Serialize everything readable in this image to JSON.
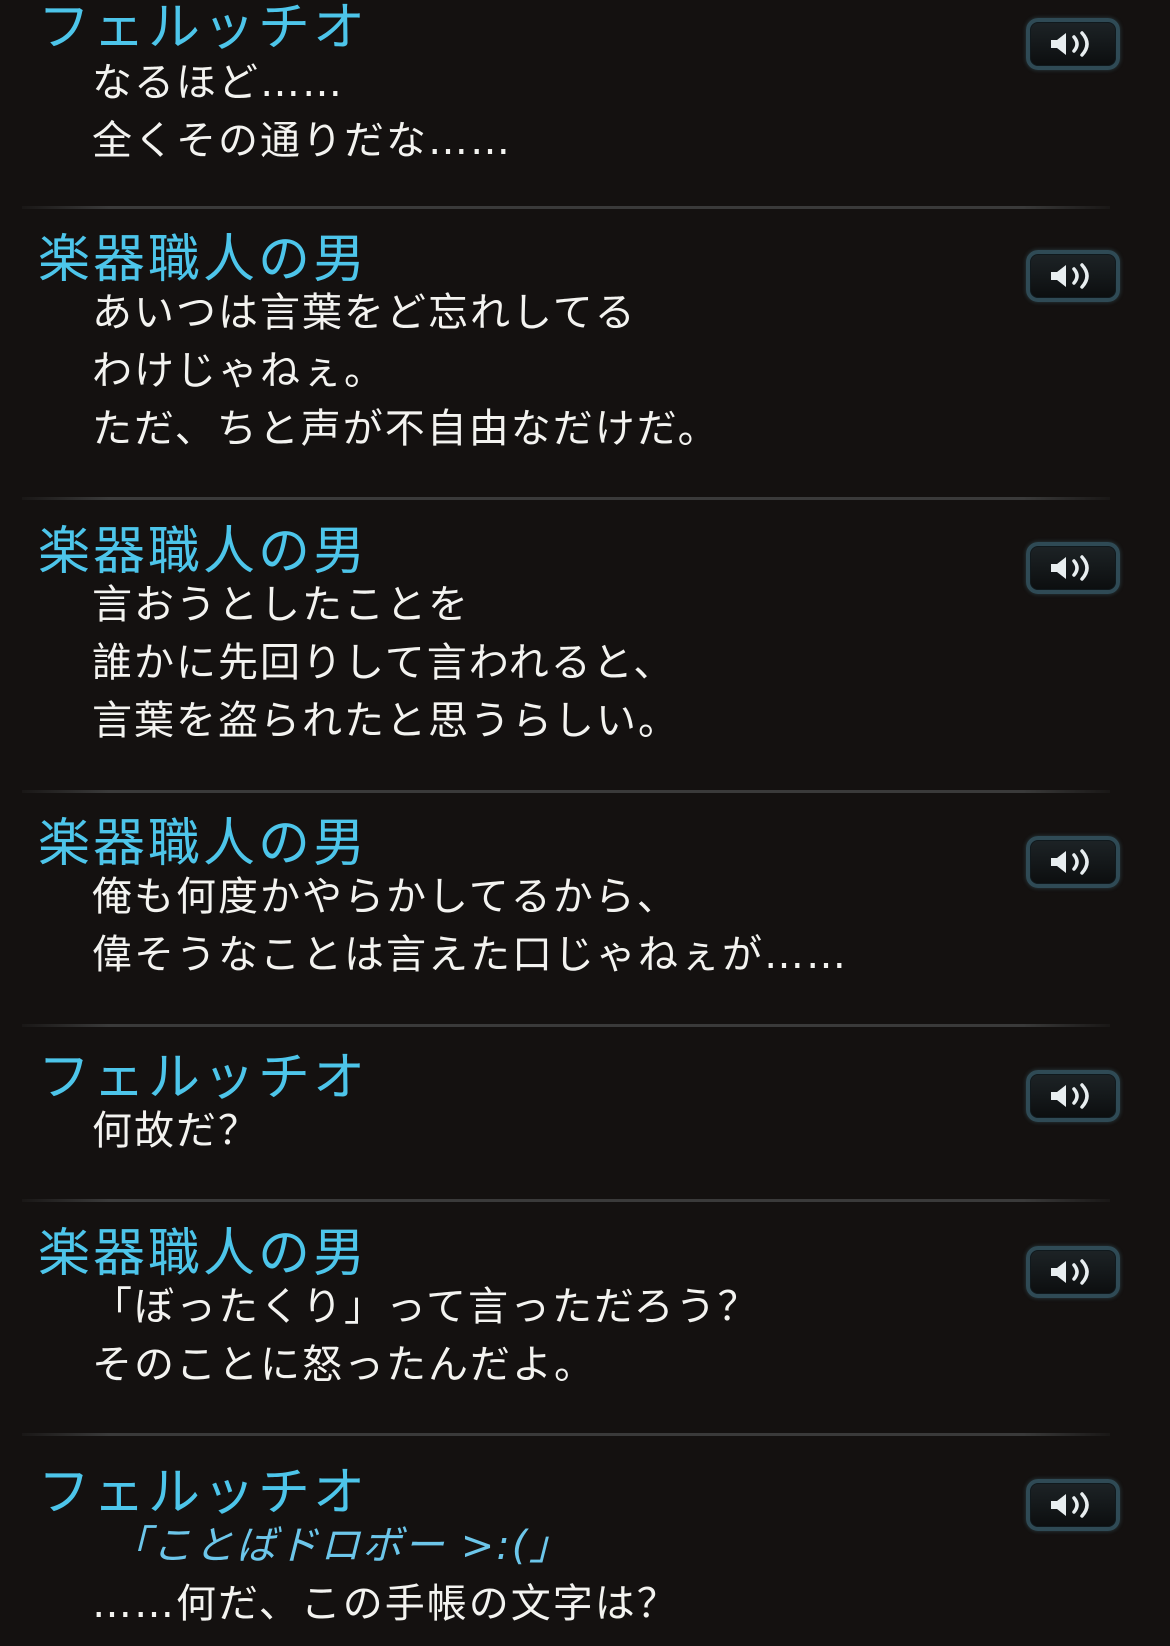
{
  "entries": [
    {
      "speaker": "フェルッチオ",
      "lines": [
        "なるほど……",
        "全くその通りだな……"
      ],
      "voice_icon": "speaker-volume-icon"
    },
    {
      "speaker": "楽器職人の男",
      "lines": [
        "あいつは言葉をど忘れしてる",
        "わけじゃねぇ。",
        "ただ、ちと声が不自由なだけだ。"
      ],
      "voice_icon": "speaker-volume-icon"
    },
    {
      "speaker": "楽器職人の男",
      "lines": [
        "言おうとしたことを",
        "誰かに先回りして言われると、",
        "言葉を盗られたと思うらしい。"
      ],
      "voice_icon": "speaker-volume-icon"
    },
    {
      "speaker": "楽器職人の男",
      "lines": [
        "俺も何度かやらかしてるから、",
        "偉そうなことは言えた口じゃねぇが……"
      ],
      "voice_icon": "speaker-volume-icon"
    },
    {
      "speaker": "フェルッチオ",
      "lines": [
        "何故だ？"
      ],
      "voice_icon": "speaker-volume-icon"
    },
    {
      "speaker": "楽器職人の男",
      "lines": [
        "「ぼったくり」って言っただろう？",
        "そのことに怒ったんだよ。"
      ],
      "voice_icon": "speaker-volume-icon"
    },
    {
      "speaker": "フェルッチオ",
      "note": "「ことばドロボー >:(」",
      "lines": [
        "……何だ、この手帳の文字は？"
      ],
      "voice_icon": "speaker-volume-icon"
    }
  ],
  "colors": {
    "background": "#141110",
    "speaker_name": "#4dc5ea",
    "dialogue_text": "#f3f3f0",
    "note_text": "#6cc6ea",
    "button_border": "#2f4a55",
    "divider": "#3a3a3a"
  }
}
